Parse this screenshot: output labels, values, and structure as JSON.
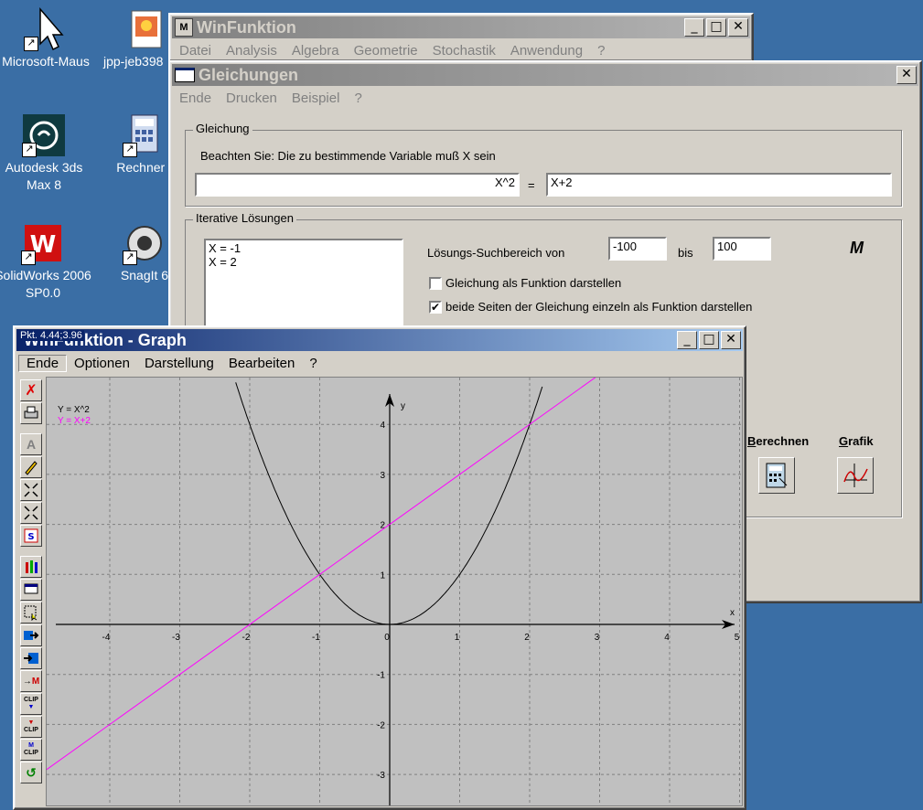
{
  "desktop": {
    "icons": [
      {
        "label": "Microsoft-Maus"
      },
      {
        "label": "jpp-jeb398"
      },
      {
        "label": "Autodesk 3ds Max 8"
      },
      {
        "label": "Rechner ("
      },
      {
        "label": "SolidWorks 2006 SP0.0"
      },
      {
        "label": "SnagIt 6"
      }
    ]
  },
  "main_window": {
    "title": "WinFunktion",
    "menu": [
      "Datei",
      "Analysis",
      "Algebra",
      "Geometrie",
      "Stochastik",
      "Anwendung",
      "?"
    ]
  },
  "equation_window": {
    "title": "Gleichungen",
    "menu": [
      "Ende",
      "Drucken",
      "Beispiel",
      "?"
    ],
    "group_equation": {
      "legend": "Gleichung",
      "hint": "Beachten Sie: Die zu bestimmende Variable muß X sein",
      "left_value": "X^2",
      "equals": "=",
      "right_value": "X+2"
    },
    "group_iterative": {
      "legend": "Iterative Lösungen",
      "solutions": [
        "X = -1",
        "X = 2"
      ],
      "range_label": "Lösungs-Suchbereich von",
      "range_from": "-100",
      "range_to_label": "bis",
      "range_to": "100",
      "option1_label": "Gleichung als Funktion darstellen",
      "option1_checked": false,
      "option2_label": "beide Seiten der Gleichung einzeln als Funktion darstellen",
      "option2_checked": true,
      "check_mark": "✔",
      "calc_label_prefix": "B",
      "calc_label_rest": "erechnen",
      "graph_label_prefix": "G",
      "graph_label_rest": "rafik"
    }
  },
  "graph_window": {
    "title": "WinFunktion - Graph",
    "coord_readout": "Pkt. 4.44;3.96",
    "menu": [
      "Ende",
      "Optionen",
      "Darstellung",
      "Bearbeiten",
      "?"
    ],
    "legend": [
      {
        "text": "Y = X^2",
        "color": "#000000"
      },
      {
        "text": "Y = X+2",
        "color": "#ff00ff"
      }
    ],
    "axis_x_label": "x",
    "axis_y_label": "y",
    "x_ticks": [
      -4,
      -3,
      -2,
      -1,
      0,
      1,
      2,
      3,
      4,
      5
    ],
    "y_ticks": [
      4,
      3,
      2,
      1,
      -1,
      -2,
      -3
    ],
    "xlim": [
      -5,
      5
    ],
    "ylim": [
      -3.6,
      4.8
    ],
    "colors": {
      "plot_bg": "#c0c0c0",
      "parabola": "#000000",
      "line": "#ff00ff"
    },
    "toolbar_icons": [
      "close-x-icon",
      "print-icon",
      "text-a-icon",
      "pencil-icon",
      "zoom-out-icon",
      "zoom-in-icon",
      "scale-icon",
      "crayons-icon",
      "window-icon",
      "select-icon",
      "export-icon",
      "save-icon",
      "to-m-icon",
      "clip-down-icon",
      "clip-up-icon",
      "clip-m-icon",
      "undo-icon"
    ]
  }
}
